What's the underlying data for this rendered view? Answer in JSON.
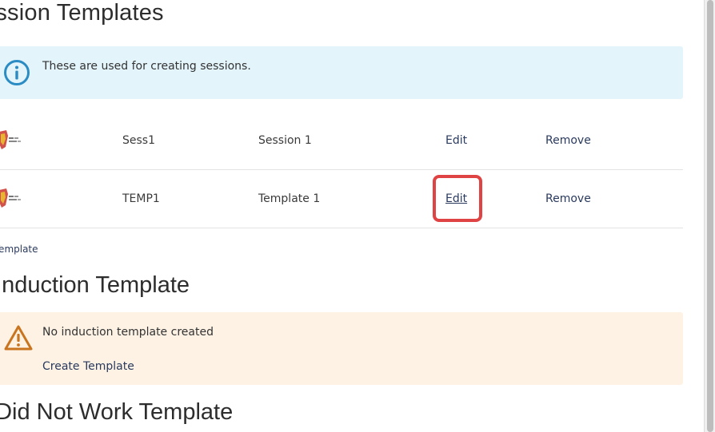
{
  "sections": {
    "session_templates_title": "ession Templates",
    "induction_title": ". Induction Template",
    "did_not_work_title": ". Did Not Work Template"
  },
  "info_alert": {
    "icon": "info-circle-icon",
    "text": "These are used for creating sessions.",
    "color": "#e3f4fb",
    "icon_color": "#2b8cc4"
  },
  "templates": [
    {
      "code": "Sess1",
      "name": "Session 1",
      "edit": "Edit",
      "remove": "Remove"
    },
    {
      "code": "TEMP1",
      "name": "Template 1",
      "edit": "Edit",
      "remove": "Remove"
    }
  ],
  "add_template_label": "ld Template",
  "warn_alert": {
    "icon": "warning-triangle-icon",
    "text": "No induction template created",
    "link": "Create Template",
    "color": "#fdf2e4",
    "icon_color": "#c9741f"
  },
  "highlight_color": "#e04343"
}
